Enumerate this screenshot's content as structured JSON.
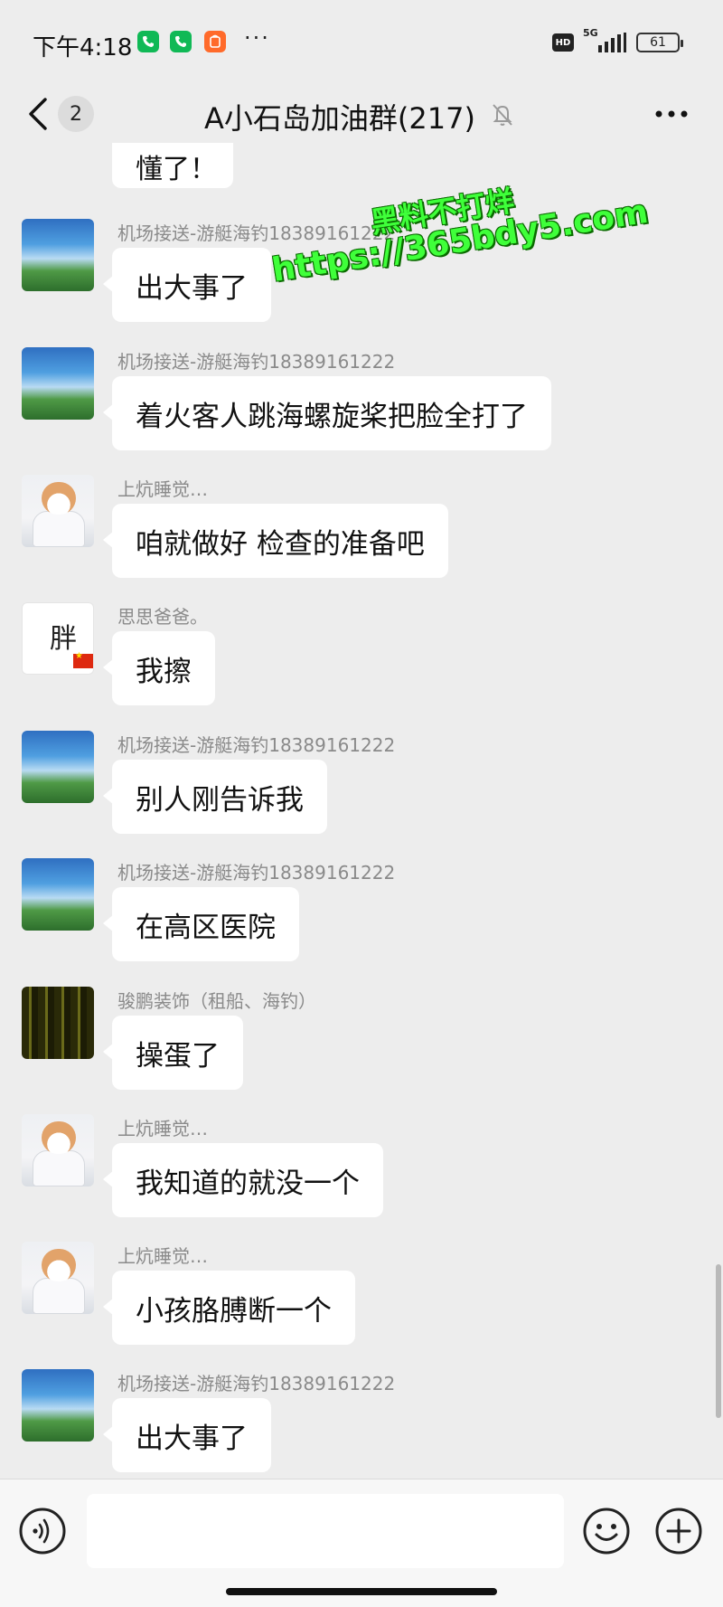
{
  "status_bar": {
    "time": "下午4:18",
    "network": "5G",
    "hd_badge": "HD",
    "battery": "61",
    "overflow_dots": "···",
    "app_icons": [
      "phone-green-icon",
      "phone-green-icon",
      "orange-app-icon"
    ]
  },
  "nav": {
    "unread_count": "2",
    "title": "A小石岛加油群(217)",
    "icons": [
      "back-icon",
      "mute-bell-icon",
      "more-icon"
    ]
  },
  "partial_message": {
    "text": "懂了！"
  },
  "messages": [
    {
      "sender": "机场接送-游艇海钓18389161222",
      "text": "出大事了",
      "avatar": "sky"
    },
    {
      "sender": "机场接送-游艇海钓18389161222",
      "text": "着火客人跳海螺旋桨把脸全打了",
      "avatar": "sky"
    },
    {
      "sender": "上炕睡觉…",
      "text": "咱就做好 检查的准备吧",
      "avatar": "cat"
    },
    {
      "sender": "思思爸爸。",
      "text": "我擦",
      "avatar": "pang"
    },
    {
      "sender": "机场接送-游艇海钓18389161222",
      "text": "别人刚告诉我",
      "avatar": "sky"
    },
    {
      "sender": "机场接送-游艇海钓18389161222",
      "text": "在高区医院",
      "avatar": "sky"
    },
    {
      "sender": "骏鹏装饰（租船、海钓）",
      "text": "操蛋了",
      "avatar": "dark"
    },
    {
      "sender": "上炕睡觉…",
      "text": "我知道的就没一个",
      "avatar": "cat"
    },
    {
      "sender": "上炕睡觉…",
      "text": "小孩胳膊断一个",
      "avatar": "cat"
    },
    {
      "sender": "机场接送-游艇海钓18389161222",
      "text": "出大事了",
      "avatar": "sky"
    }
  ],
  "avatar_pang_char": "胖",
  "watermark": {
    "line1": "黑料不打烊",
    "line2": "https://365bdy5.com"
  },
  "input_bar": {
    "placeholder": "",
    "icons": [
      "voice-icon",
      "emoji-icon",
      "plus-icon"
    ]
  },
  "colors": {
    "background": "#ededed",
    "bubble": "#ffffff",
    "sender_name": "#8a8a8a",
    "watermark": "#3fff3a",
    "wechat_green": "#07c160"
  }
}
